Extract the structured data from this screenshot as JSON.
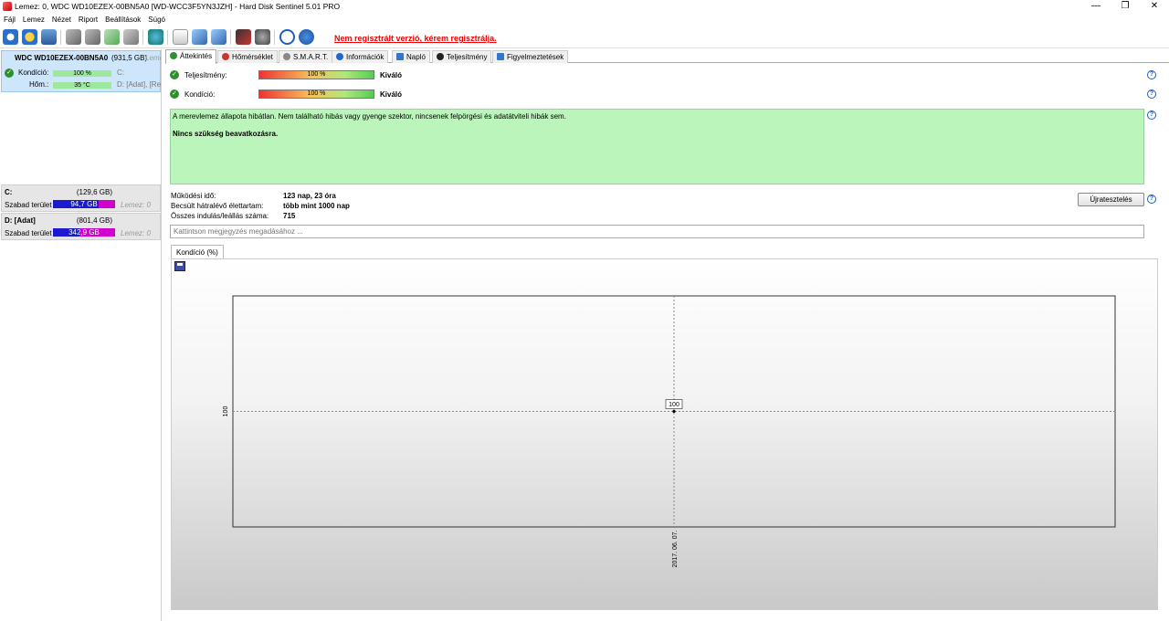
{
  "window": {
    "title": "Lemez: 0, WDC WD10EZEX-00BN5A0 [WD-WCC3F5YN3JZH]  -  Hard Disk Sentinel 5.01 PRO",
    "minimize": "—",
    "restore": "❐",
    "close": "✕"
  },
  "menu": [
    "Fájl",
    "Lemez",
    "Nézet",
    "Riport",
    "Beállítások",
    "Súgó"
  ],
  "toolbar": {
    "register_link": "Nem regisztrált verzió, kérem regisztrálja."
  },
  "sidebar": {
    "disk": {
      "name": "WDC WD10EZEX-00BN5A0",
      "size": "(931,5 GB)",
      "extra": "Lemez",
      "condition_label": "Kondíció:",
      "condition_value": "100 %",
      "condition_fraction": 1.0,
      "temp_label": "Hőm.:",
      "temp_value": "35 °C",
      "drives_line1": "C:",
      "drives_line2": "D: [Adat], [Re"
    },
    "volumes": [
      {
        "name": "C:",
        "size": "(129,6 GB)",
        "free_label": "Szabad terület",
        "free_value": "94,7 GB",
        "free_fraction": 0.73,
        "disk_label": "Lemez: 0"
      },
      {
        "name": "D: [Adat]",
        "size": "(801,4 GB)",
        "free_label": "Szabad terület",
        "free_value": "342,9 GB",
        "free_fraction": 0.43,
        "disk_label": "Lemez: 0"
      }
    ]
  },
  "tabs": [
    {
      "label": "Áttekintés",
      "active": true,
      "icon_color": "#2f8f2f"
    },
    {
      "label": "Hőmérséklet",
      "active": false,
      "icon_color": "#c33"
    },
    {
      "label": "S.M.A.R.T.",
      "active": false,
      "icon_color": "#888"
    },
    {
      "label": "Információk",
      "active": false,
      "icon_color": "#2266cc"
    },
    {
      "label": "Napló",
      "active": false,
      "icon_color": "#3377cc"
    },
    {
      "label": "Teljesítmény",
      "active": false,
      "icon_color": "#222"
    },
    {
      "label": "Figyelmeztetések",
      "active": false,
      "icon_color": "#3377cc"
    }
  ],
  "overview": {
    "performance_label": "Teljesítmény:",
    "performance_value": "100 %",
    "performance_rating": "Kiváló",
    "condition_label": "Kondíció:",
    "condition_value": "100 %",
    "condition_rating": "Kiváló",
    "message_line1": "A merevlemez állapota hibátlan. Nem található hibás vagy gyenge szektor, nincsenek felpörgési és adatátviteli hibák sem.",
    "message_line2": "Nincs szükség beavatkozásra.",
    "uptime_label": "Működési idő:",
    "uptime_value": "123 nap, 23 óra",
    "remaining_label": "Becsült hátralévő élettartam:",
    "remaining_value": "több mint 1000 nap",
    "starts_label": "Összes indulás/leállás száma:",
    "starts_value": "715",
    "retest_button": "Újratesztelés",
    "note_placeholder": "Kattintson megjegyzés megadásához ...",
    "help_glyph": "?"
  },
  "chart_tab": "Kondíció  (%)",
  "chart_data": {
    "type": "line",
    "x": [
      "2017. 06. 07."
    ],
    "series": [
      {
        "values": [
          100
        ]
      }
    ],
    "data_labels": [
      "100"
    ],
    "ytick": "100",
    "xtick": "2017. 06. 07.",
    "grid": true
  }
}
